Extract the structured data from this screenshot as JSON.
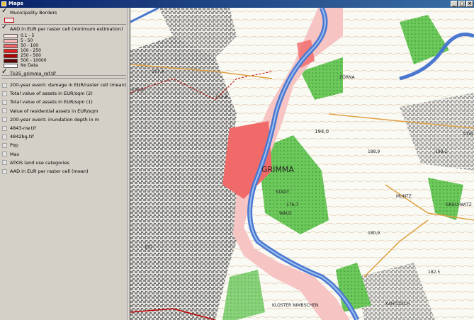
{
  "window": {
    "title": "Maps",
    "controls": [
      "_",
      "□",
      "×"
    ]
  },
  "legend": {
    "municipality": {
      "name": "Municipality Borders",
      "checked": true
    },
    "aad_min": {
      "name": "AAD in EUR per raster cell (minimum estimation)",
      "checked": true,
      "classes": [
        {
          "label": "0.1 - 5",
          "color": "#fbe4e4"
        },
        {
          "label": "5 - 50",
          "color": "#f7b8b8"
        },
        {
          "label": "50 - 100",
          "color": "#f06a6a"
        },
        {
          "label": "100 - 250",
          "color": "#e02020"
        },
        {
          "label": "250 - 500",
          "color": "#b00000"
        },
        {
          "label": "500 - 10000",
          "color": "#600000"
        },
        {
          "label": "No Data",
          "color": "#ffffff"
        }
      ]
    },
    "tk25": {
      "name": "Tk25_grimma_ref.tif",
      "checked": true
    },
    "layers": [
      {
        "name": "200-year event: damage in EUR/raster cell (mean)",
        "checked": false
      },
      {
        "name": "Total value of assets in EUR/sqm (2)",
        "checked": false
      },
      {
        "name": "Total value of assets in EUR/sqm (1)",
        "checked": false
      },
      {
        "name": "Value of residential assets in EUR/sqm",
        "checked": false
      },
      {
        "name": "200-year event: inundation depth in m",
        "checked": false
      },
      {
        "name": "4843-nw.tif",
        "checked": false
      },
      {
        "name": "4842bg.tif",
        "checked": false
      },
      {
        "name": "Pop",
        "checked": false
      },
      {
        "name": "Max",
        "checked": false
      },
      {
        "name": "ATKIS land use categories",
        "checked": false
      },
      {
        "name": "AAD in EUR per raster cell (mean)",
        "checked": false
      }
    ]
  },
  "map": {
    "labels": [
      {
        "text": "GRIMMA"
      },
      {
        "text": "194,0"
      },
      {
        "text": "199,2"
      },
      {
        "text": "177,4"
      },
      {
        "text": "175,4"
      },
      {
        "text": "153,6"
      },
      {
        "text": "188,9"
      },
      {
        "text": "180,9"
      },
      {
        "text": "182,5"
      },
      {
        "text": "176,7"
      },
      {
        "text": "157"
      },
      {
        "text": "KLOSTER NIMBSCHEN"
      },
      {
        "text": "MUNTZ"
      },
      {
        "text": "GRECHWITZ"
      },
      {
        "text": "KAHITZSCH"
      },
      {
        "text": "DÖB"
      },
      {
        "text": "ZÖRNA"
      },
      {
        "text": "STADT"
      },
      {
        "text": "WALD"
      }
    ],
    "colors": {
      "river": "#4a78d0",
      "flood": "#f7c4c4",
      "flood_high": "#f06a6a",
      "forest": "#5fbf50",
      "urban": "#8a8a8a",
      "paper": "#fafaf5"
    }
  }
}
